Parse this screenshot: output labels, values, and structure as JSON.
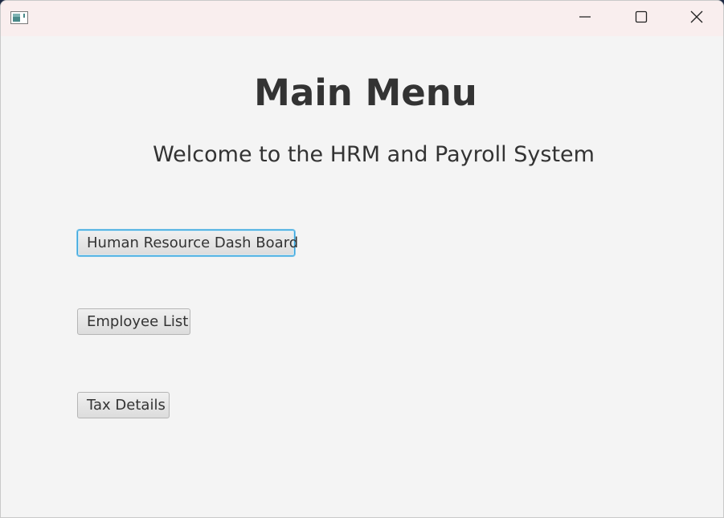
{
  "window": {
    "icon": "java-app-icon",
    "controls": {
      "minimize_icon": "minimize-icon",
      "maximize_icon": "maximize-icon",
      "close_icon": "close-icon"
    }
  },
  "main": {
    "title": "Main Menu",
    "subtitle": "Welcome to the HRM and Payroll System",
    "buttons": {
      "hr_dashboard": "Human Resource Dash Board",
      "employee_list": "Employee List",
      "tax_details": "Tax Details"
    }
  },
  "colors": {
    "titlebar": "#f9eeee",
    "background": "#f4f4f4",
    "text": "#333333",
    "focus_ring": "#39a5dc"
  }
}
